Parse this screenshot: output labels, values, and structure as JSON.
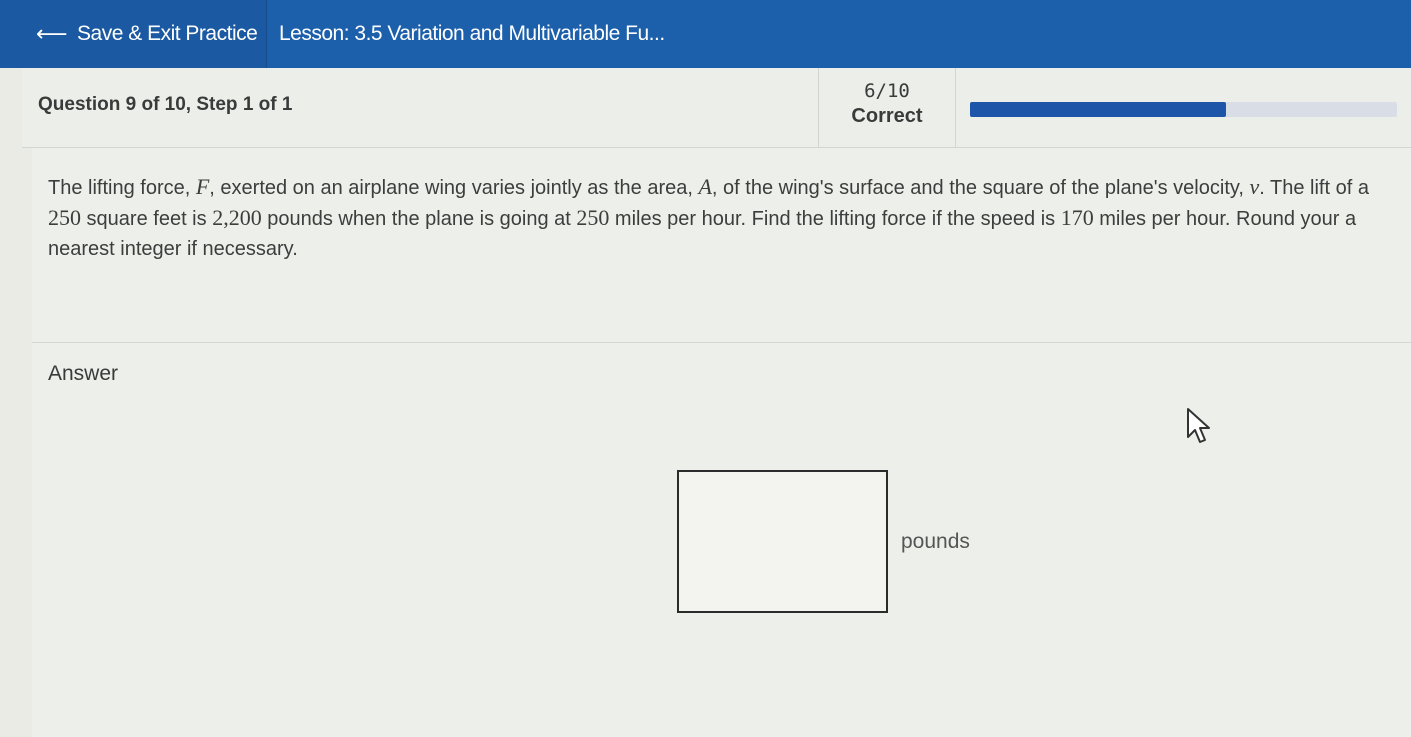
{
  "topbar": {
    "exit_label": "Save & Exit Practice",
    "lesson_title": "Lesson: 3.5 Variation and Multivariable Fu...",
    "color": "#1c5fab"
  },
  "header": {
    "question_title": "Question 9 of 10,  Step 1 of 1",
    "score_fraction": "6/10",
    "score_label": "Correct",
    "progress": 0.6
  },
  "problem": {
    "line1_a": "The lifting force, ",
    "var_F": "F",
    "line1_b": ", exerted on an airplane wing varies jointly as the area, ",
    "var_A": "A",
    "line1_c": ", of the wing's surface and the square of the plane's velocity, ",
    "var_v": "v",
    "line1_d": ". The lift of a",
    "num_area": "250",
    "line2_a": " square feet is ",
    "num_lift": "2,200",
    "line2_b": " pounds when the plane is going at ",
    "num_speed1": "250",
    "line2_c": " miles per hour. Find the lifting force if the speed is ",
    "num_speed2": "170",
    "line2_d": " miles per hour. Round your a",
    "line3": "nearest integer if necessary."
  },
  "answer": {
    "label": "Answer",
    "value": "",
    "unit": "pounds"
  },
  "colors": {
    "accent": "#1c5fab",
    "progress_fill": "#1d56a8",
    "progress_track": "#d9dde6"
  }
}
